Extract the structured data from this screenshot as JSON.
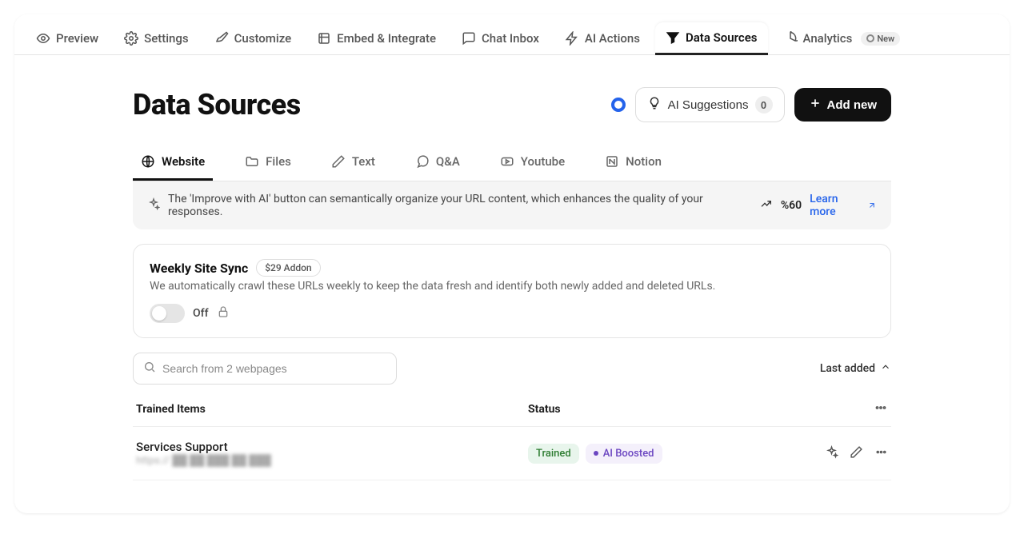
{
  "nav": {
    "items": [
      {
        "label": "Preview",
        "icon": "eye"
      },
      {
        "label": "Settings",
        "icon": "gear"
      },
      {
        "label": "Customize",
        "icon": "brush"
      },
      {
        "label": "Embed & Integrate",
        "icon": "embed"
      },
      {
        "label": "Chat Inbox",
        "icon": "chat"
      },
      {
        "label": "AI Actions",
        "icon": "bolt"
      },
      {
        "label": "Data Sources",
        "icon": "funnel"
      },
      {
        "label": "Analytics",
        "icon": "pie"
      }
    ],
    "new_badge": "New"
  },
  "header": {
    "title": "Data Sources",
    "ai_suggestions_label": "AI Suggestions",
    "ai_suggestions_count": "0",
    "add_new_label": "Add new"
  },
  "sub_tabs": [
    {
      "label": "Website"
    },
    {
      "label": "Files"
    },
    {
      "label": "Text"
    },
    {
      "label": "Q&A"
    },
    {
      "label": "Youtube"
    },
    {
      "label": "Notion"
    }
  ],
  "banner": {
    "text": "The 'Improve with AI' button can semantically organize your URL content, which enhances the quality of your responses.",
    "pct": "%60",
    "learn_more": "Learn more"
  },
  "sync": {
    "title": "Weekly Site Sync",
    "addon": "$29 Addon",
    "desc": "We automatically crawl these URLs weekly to keep the data fresh and identify both newly added and deleted URLs.",
    "toggle_state": "Off"
  },
  "search": {
    "placeholder": "Search from 2 webpages"
  },
  "sort": {
    "label": "Last added"
  },
  "table": {
    "col_items": "Trained Items",
    "col_status": "Status",
    "rows": [
      {
        "title": "Services Support",
        "url": "https:// ██ ██ ███ ██ ███",
        "status_trained": "Trained",
        "status_boosted": "AI Boosted"
      }
    ]
  }
}
